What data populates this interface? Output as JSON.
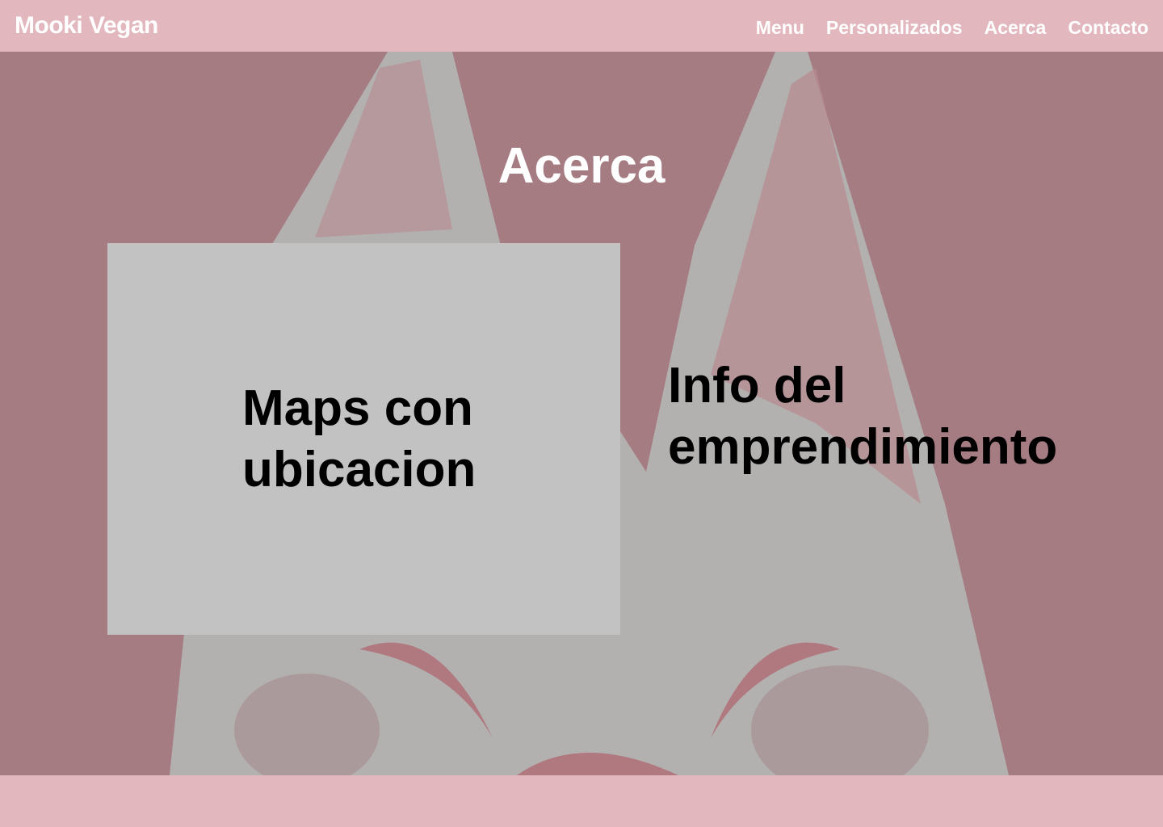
{
  "header": {
    "brand": "Mooki Vegan",
    "nav": [
      "Menu",
      "Personalizados",
      "Acerca",
      "Contacto"
    ]
  },
  "main": {
    "title": "Acerca",
    "map_placeholder": "Maps con ubicacion",
    "info_placeholder": "Info del emprendimiento"
  },
  "colors": {
    "header": "#e2b7be",
    "background": "#a67c83",
    "map_box": "#c2c2c2"
  }
}
